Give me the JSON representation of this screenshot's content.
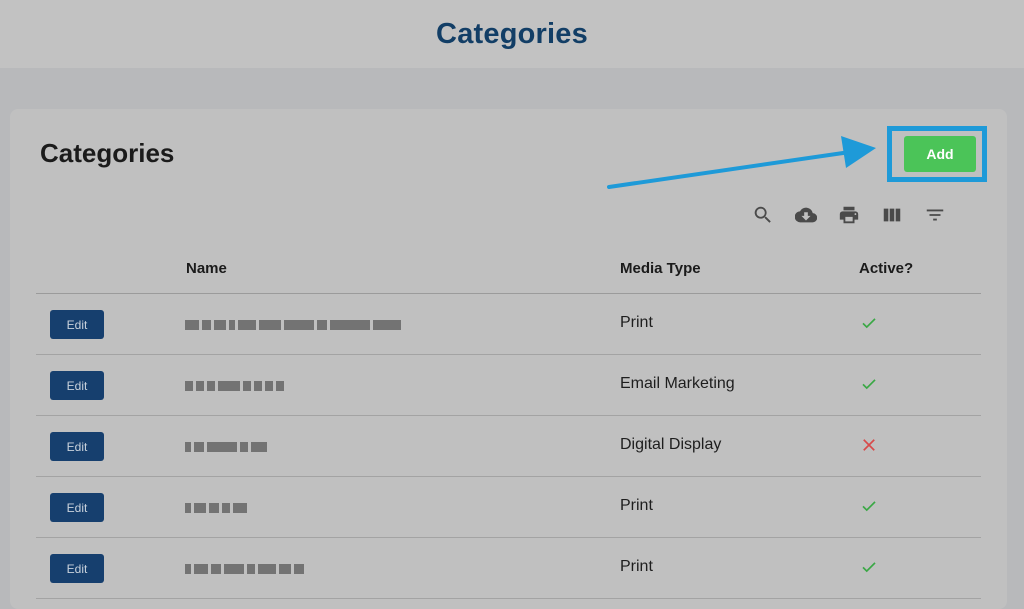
{
  "page_header": {
    "title": "Categories"
  },
  "card": {
    "title": "Categories",
    "add_label": "Add"
  },
  "toolbar": {
    "icons": [
      "search-icon",
      "cloud-download-icon",
      "print-icon",
      "view-columns-icon",
      "filter-icon"
    ]
  },
  "table": {
    "columns": [
      "",
      "Name",
      "Media Type",
      "Active?"
    ],
    "edit_label": "Edit",
    "rows": [
      {
        "media_type": "Print",
        "active": true
      },
      {
        "media_type": "Email Marketing",
        "active": true
      },
      {
        "media_type": "Digital Display",
        "active": false
      },
      {
        "media_type": "Print",
        "active": true
      },
      {
        "media_type": "Print",
        "active": true
      }
    ]
  },
  "colors": {
    "header_title": "#123e66",
    "add_button": "#4bc458",
    "edit_button": "#163f6e",
    "highlight": "#1e9ad8",
    "active_true": "#3aa845",
    "active_false": "#d84a4a"
  }
}
